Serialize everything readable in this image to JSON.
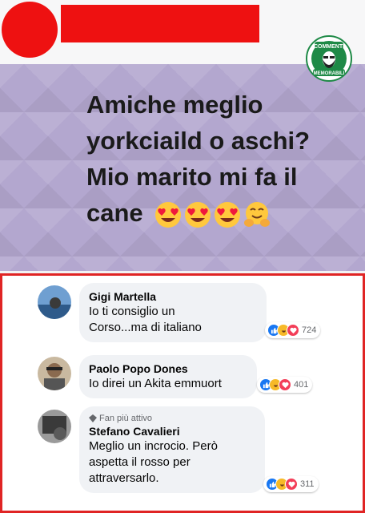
{
  "post": {
    "lines": [
      "Amiche meglio",
      "yorkciaild o aschi?",
      "Mio marito mi fa il",
      "cane"
    ],
    "emojis": [
      "heart-eyes-emoji",
      "heart-eyes-emoji",
      "heart-eyes-emoji",
      "hugging-emoji"
    ]
  },
  "logo": {
    "top_text": "COMMENTI",
    "bottom_text": "MEMORABILI"
  },
  "comments": [
    {
      "name": "Gigi Martella",
      "lines": [
        "Io ti consiglio un",
        "Corso...ma di italiano"
      ],
      "reaction_count": "724"
    },
    {
      "name": "Paolo Popo Dones",
      "lines": [
        "Io direi un Akita emmuort"
      ],
      "reaction_count": "401"
    },
    {
      "badge": "Fan più attivo",
      "name": "Stefano Cavalieri",
      "lines": [
        "Meglio un incrocio. Però",
        "aspetta il rosso per",
        "attraversarlo."
      ],
      "reaction_count": "311"
    }
  ],
  "colors": {
    "redaction": "#ee1111",
    "post_bg": "#b3a7cf",
    "frame": "#e02424",
    "like": "#1877f2",
    "haha": "#f7b928",
    "love": "#f33e58",
    "logo_green": "#1f8a47"
  }
}
